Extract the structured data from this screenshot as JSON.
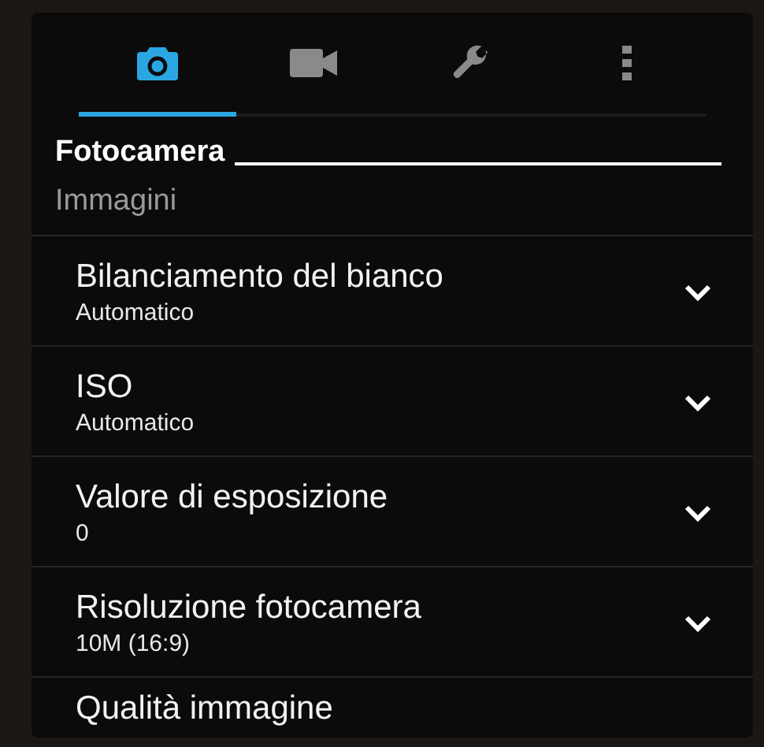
{
  "tabs": [
    {
      "kind": "camera",
      "selected": true
    },
    {
      "kind": "video",
      "selected": false
    },
    {
      "kind": "wrench",
      "selected": false
    },
    {
      "kind": "more",
      "selected": false
    }
  ],
  "section": {
    "title": "Fotocamera",
    "subtitle": "Immagini"
  },
  "settings": [
    {
      "title": "Bilanciamento del bianco",
      "value": "Automatico",
      "expanded": false
    },
    {
      "title": "ISO",
      "value": "Automatico",
      "expanded": false
    },
    {
      "title": "Valore di esposizione",
      "value": "0",
      "expanded": false
    },
    {
      "title": "Risoluzione fotocamera",
      "value": "10M (16:9)",
      "expanded": false
    },
    {
      "title": "Qualità immagine"
    }
  ]
}
